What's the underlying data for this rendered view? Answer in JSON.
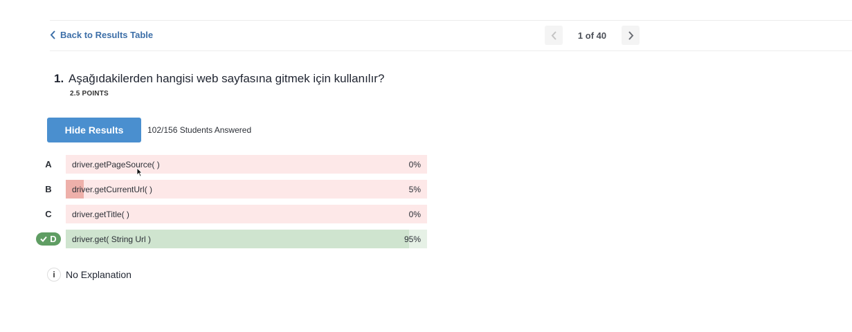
{
  "nav": {
    "back_label": "Back to Results Table",
    "pager_text": "1 of 40"
  },
  "question": {
    "number": "1.",
    "text": "Aşağıdakilerden hangisi web sayfasına gitmek için kullanılır?",
    "points": "2.5 POINTS"
  },
  "results": {
    "hide_label": "Hide Results",
    "answered": "102/156 Students Answered"
  },
  "options": [
    {
      "letter": "A",
      "text": "driver.getPageSource( )",
      "percent_label": "0%",
      "percent": 0,
      "correct": false
    },
    {
      "letter": "B",
      "text": "driver.getCurrentUrl( )",
      "percent_label": "5%",
      "percent": 5,
      "correct": false
    },
    {
      "letter": "C",
      "text": "driver.getTitle( )",
      "percent_label": "0%",
      "percent": 0,
      "correct": false
    },
    {
      "letter": "D",
      "text": "driver.get( String Url )",
      "percent_label": "95%",
      "percent": 95,
      "correct": true
    }
  ],
  "explanation": {
    "icon_label": "i",
    "text": "No Explanation"
  },
  "colors": {
    "accent": "#4a8fcf",
    "link": "#3d6fa8",
    "correct": "#5f9d63",
    "wrong_bg": "#fde8e8",
    "wrong_fill": "#eeb0aa",
    "correct_bg": "#e6f1e6",
    "correct_fill": "#cfe4cf"
  }
}
